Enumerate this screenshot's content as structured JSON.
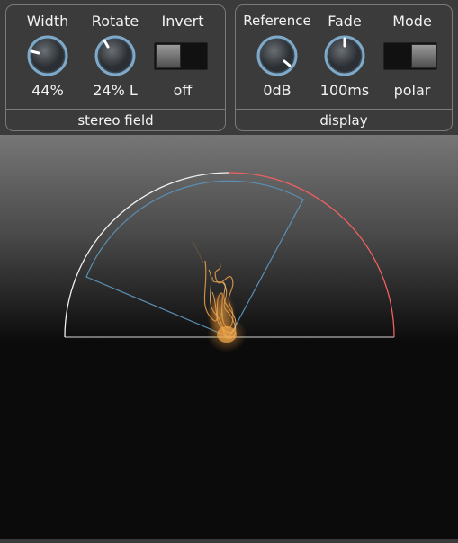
{
  "stereo_field": {
    "title": "stereo field",
    "width": {
      "label": "Width",
      "value": "44%"
    },
    "rotate": {
      "label": "Rotate",
      "value": "24% L"
    },
    "invert": {
      "label": "Invert",
      "value": "off"
    }
  },
  "display": {
    "title": "display",
    "reference": {
      "label": "Reference",
      "value": "0dB"
    },
    "fade": {
      "label": "Fade",
      "value": "100ms"
    },
    "mode": {
      "label": "Mode",
      "value": "polar"
    }
  },
  "colors": {
    "knob_ring": "#7fa9c8",
    "left_arc": "#f0f0f0",
    "right_arc": "#f06060",
    "sector": "#5b8fb3",
    "signal": "#f0a040"
  },
  "icons": {
    "knob": "rotary-knob-icon",
    "toggle": "toggle-switch-icon"
  }
}
